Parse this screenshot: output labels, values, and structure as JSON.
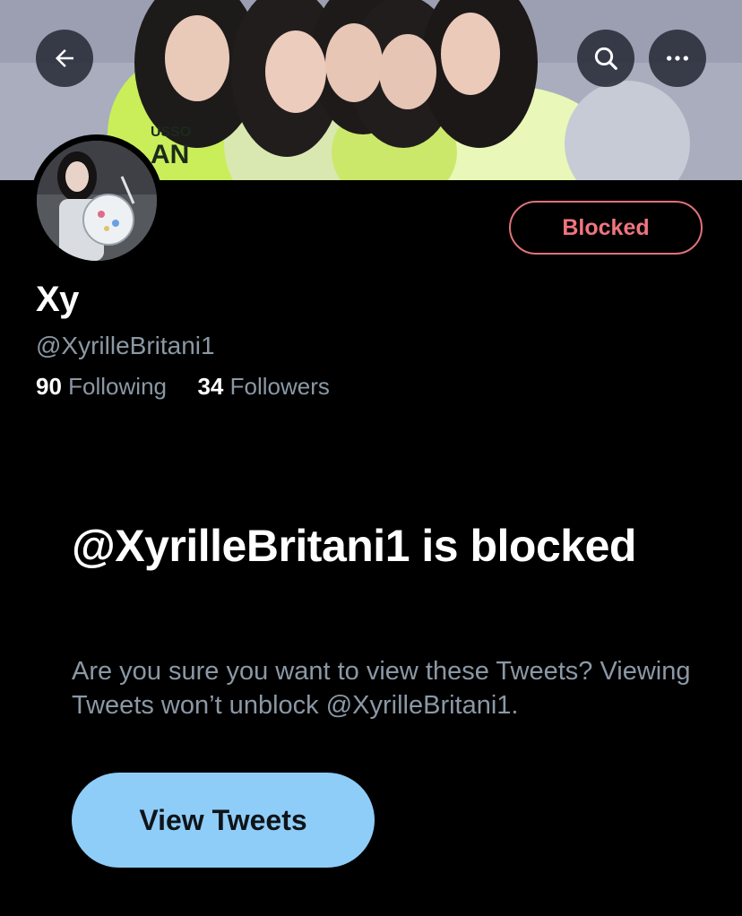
{
  "header": {
    "back_icon": "arrow-left-icon",
    "search_icon": "search-icon",
    "more_icon": "more-horizontal-icon"
  },
  "profile": {
    "name": "Xy",
    "handle": "@XyrilleBritani1",
    "following_count": "90",
    "following_label": "Following",
    "followers_count": "34",
    "followers_label": "Followers",
    "blocked_label": "Blocked"
  },
  "blocked_notice": {
    "title": "@XyrilleBritani1 is blocked",
    "description": "Are you sure you want to view these Tweets? Viewing Tweets won’t unblock @XyrilleBritani1.",
    "button_label": "View Tweets"
  },
  "colors": {
    "background": "#000000",
    "blocked_red": "#f0757e",
    "secondary_text": "#8b98a5",
    "primary_button": "#8ecdf8"
  }
}
